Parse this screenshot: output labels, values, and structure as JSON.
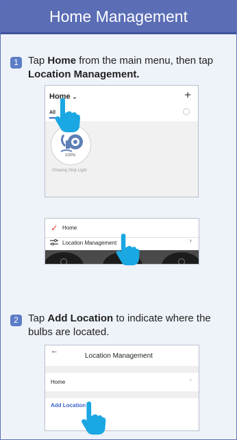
{
  "header": {
    "title": "Home Management"
  },
  "steps": [
    {
      "number": "1",
      "text_parts": [
        "Tap ",
        "Home",
        " from the main menu, then tap ",
        "Location Management."
      ]
    },
    {
      "number": "2",
      "text_parts": [
        "Tap ",
        "Add Location",
        " to indicate where the bulbs are located."
      ]
    }
  ],
  "screen1": {
    "home_label": "Home",
    "add_icon": "+",
    "tab_all": "All",
    "device_percent": "100%",
    "device_name": "Chasing Strip Light"
  },
  "screen2": {
    "item_home": "Home",
    "item_location": "Location Management"
  },
  "screen3": {
    "title": "Location Management",
    "item_home": "Home",
    "item_add": "Add Location"
  },
  "colors": {
    "header": "#5a6db5",
    "accent_blue": "#3c64c8",
    "check_red": "#e8452c",
    "hand_blue": "#1ba7e2"
  }
}
